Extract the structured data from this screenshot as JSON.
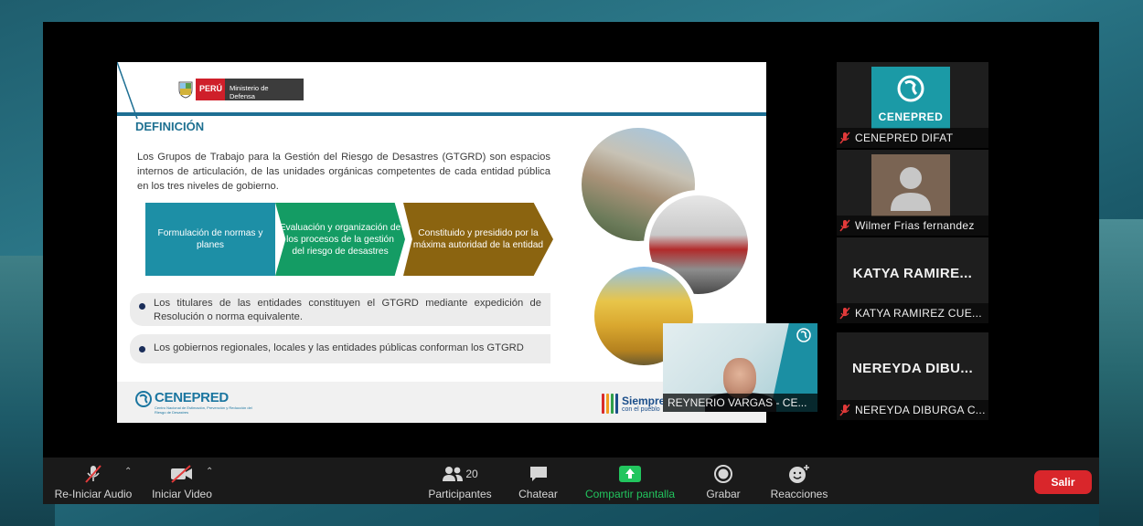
{
  "slide": {
    "gov_peru": "PERÚ",
    "gov_ministry": "Ministerio de Defensa",
    "title": "DEFINICIÓN",
    "body": "Los Grupos de Trabajo para la Gestión del Riesgo de Desastres (GTGRD) son espacios internos de articulación, de las unidades orgánicas competentes de cada entidad pública en los tres niveles de gobierno.",
    "flow": [
      "Formulación de normas y planes",
      "Evaluación y organización de los procesos de la gestión del riesgo de desastres",
      "Constituido y presidido por la máxima autoridad de la entidad"
    ],
    "bullets": [
      "Los titulares de las entidades constituyen el GTGRD mediante  expedición de Resolución o norma equivalente.",
      "Los gobiernos regionales, locales y las entidades públicas conforman los GTGRD"
    ],
    "footer_logo": "CENEPRED",
    "footer_logo_sub": "Centro Nacional de Estimación, Prevención y Reducción del Riesgo de Desastres",
    "footer_slogan": "Siempre",
    "footer_slogan_sub": "con el pueblo"
  },
  "speaker": {
    "name": "REYNERIO VARGAS - CE..."
  },
  "gallery": [
    {
      "label": "CENEPRED DIFAT",
      "tile_text": "CENEPRED",
      "type": "logo"
    },
    {
      "label": "Wilmer Frias fernandez",
      "type": "avatar"
    },
    {
      "label": "KATYA RAMIREZ CUE...",
      "tile_text": "KATYA RAMIRE...",
      "type": "name"
    },
    {
      "label": "NEREYDA DIBURGA C...",
      "tile_text": "NEREYDA DIBU...",
      "type": "name"
    }
  ],
  "toolbar": {
    "audio_label": "Re-Iniciar Audio",
    "video_label": "Iniciar Video",
    "participants_label": "Participantes",
    "participants_count": "20",
    "chat_label": "Chatear",
    "share_label": "Compartir pantalla",
    "record_label": "Grabar",
    "reactions_label": "Reacciones",
    "leave_label": "Salir"
  },
  "colors": {
    "accent_share": "#22c55e",
    "leave_button": "#d9262b",
    "slide_title": "#1e7091",
    "flow_teal": "#1d8fa6",
    "flow_green": "#149c64",
    "flow_brown": "#8b6410"
  },
  "icons": [
    "microphone-muted-icon",
    "video-off-icon",
    "participants-icon",
    "chat-icon",
    "share-screen-icon",
    "record-icon",
    "reactions-icon",
    "caret-up-icon"
  ]
}
